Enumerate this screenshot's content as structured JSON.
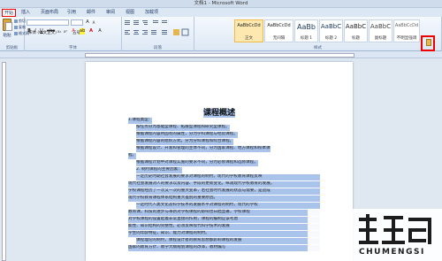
{
  "window": {
    "title": "文档1 - Microsoft Word"
  },
  "tabs": [
    {
      "label": "开始",
      "active": true
    },
    {
      "label": "插入"
    },
    {
      "label": "页面布局"
    },
    {
      "label": "引用"
    },
    {
      "label": "邮件"
    },
    {
      "label": "审阅"
    },
    {
      "label": "视图"
    },
    {
      "label": "加载项"
    }
  ],
  "ribbon": {
    "clipboard": {
      "paste": "粘贴",
      "cut": "剪切",
      "copy": "复制",
      "format_painter": "格式刷",
      "group": "剪贴板"
    },
    "font": {
      "name": "宋体 (中文正文)",
      "size": "五号",
      "group": "字体"
    },
    "paragraph": {
      "group": "段落"
    },
    "styles": {
      "group": "样式",
      "items": [
        {
          "preview": "AaBbCcDd",
          "name": "正文"
        },
        {
          "preview": "AaBbCcDd",
          "name": "无间隔"
        },
        {
          "preview": "AaBb",
          "name": "标题 1"
        },
        {
          "preview": "AaBbC",
          "name": "标题 2"
        },
        {
          "preview": "AaBbC",
          "name": "标题"
        },
        {
          "preview": "AaBbC",
          "name": "副标题"
        },
        {
          "preview": "AaBbCcDd",
          "name": "不明显强调"
        }
      ],
      "change_styles": "更改样式"
    }
  },
  "document": {
    "title": "课程概述",
    "lines": [
      "1.课程类型：",
      "按任务分为基础型课程、拓展型课程和研究型课程。",
      "根据课程内容所固有的属性，分为学科课程与经验课程。",
      "根据课程内容的组织方式，分为分科课程和综合课程。",
      "根据课程设计、开发和管理的主体不同，分为国家课程、地方课程和校本课",
      "程。",
      "根据课程计划中对课程实施的要求不同，分为必修课程和选修课程。",
      "2. 制约课程的主要因素：",
      "一定历史时期社会发展的要求对课程的制约，现代的学校教育课程反映",
      "现代社会发展对人的要求以及内容、手段的更新变化，纵观现代学校教育的发展，",
      "学校课程经历了一次又一次的重大变革，若社会时代发展的状态与需要，是造成",
      "现代学校教育课程体系结构重大差别的重要原因。",
      "一定时代人类文化及科学技术的发展水平对课程的制约，现代的学校",
      "教育课，科技的进步与革新对学校课程的影响也日趋显著，学校课程",
      "对学校课程的设置起着非常直接的作用，课程的编制应该考虑",
      "能性、知识结构的完整性，必须反映现代科学技术的发展",
      "学生的年龄特征，知识、能力对课程的制约。",
      "课程理论的制约，课程设计者的教育思想都影响课程的发展",
      "国家的教育方针、教学大纲规划课程的改革，教材编写"
    ]
  },
  "watermark": {
    "brand": "CHUMENGSI"
  }
}
